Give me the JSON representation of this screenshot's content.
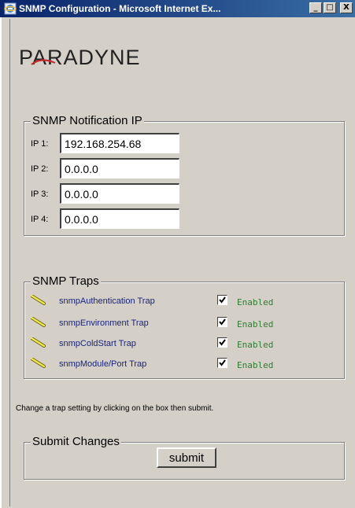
{
  "window": {
    "title": "SNMP Configuration - Microsoft Internet Ex...",
    "minimize_glyph": "_",
    "maximize_glyph": "□",
    "close_glyph": "X"
  },
  "brand": {
    "logo_text": "PARADYNE"
  },
  "notification": {
    "legend": "SNMP Notification IP",
    "ips": [
      {
        "label": "IP 1:",
        "value": "192.168.254.68"
      },
      {
        "label": "IP 2:",
        "value": "0.0.0.0"
      },
      {
        "label": "IP 3:",
        "value": "0.0.0.0"
      },
      {
        "label": "IP 4:",
        "value": "0.0.0.0"
      }
    ]
  },
  "traps": {
    "legend": "SNMP Traps",
    "items": [
      {
        "name": "snmpAuthentication Trap",
        "checked": true,
        "status": "Enabled"
      },
      {
        "name": "snmpEnvironment Trap",
        "checked": true,
        "status": "Enabled"
      },
      {
        "name": "snmpColdStart Trap",
        "checked": true,
        "status": "Enabled"
      },
      {
        "name": "snmpModule/Port Trap",
        "checked": true,
        "status": "Enabled"
      }
    ],
    "icon": "pencil-icon"
  },
  "instructions": "Change a trap setting by clicking on the box then submit.",
  "submit": {
    "legend": "Submit Changes",
    "button_label": "submit"
  },
  "colors": {
    "titlebar": "#0a246a",
    "trap_name": "#1a237e",
    "status": "#2e7d32",
    "face": "#d4d0c8"
  }
}
